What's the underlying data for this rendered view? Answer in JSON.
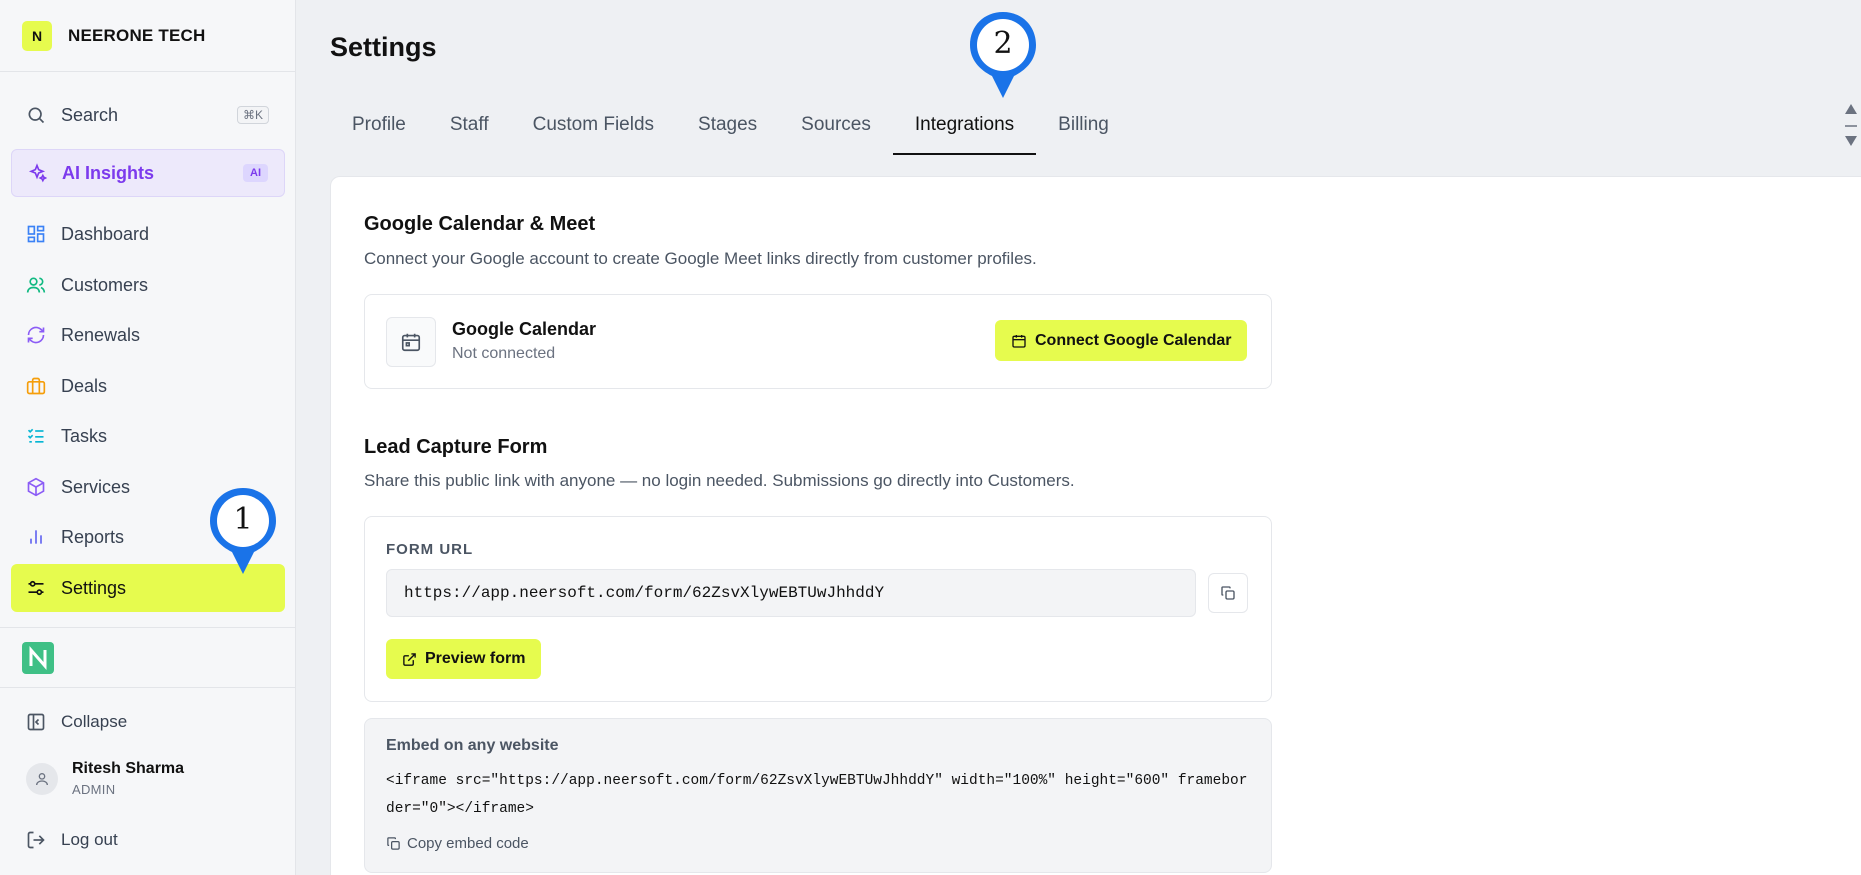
{
  "sidebar": {
    "brand": {
      "logo_letter": "N",
      "name": "NEERONE TECH"
    },
    "search": {
      "label": "Search",
      "shortcut": "⌘K"
    },
    "ai": {
      "label": "AI Insights",
      "badge": "AI"
    },
    "items": [
      {
        "label": "Dashboard",
        "icon": "grid-icon"
      },
      {
        "label": "Customers",
        "icon": "users-icon"
      },
      {
        "label": "Renewals",
        "icon": "refresh-icon"
      },
      {
        "label": "Deals",
        "icon": "briefcase-icon"
      },
      {
        "label": "Tasks",
        "icon": "checklist-icon"
      },
      {
        "label": "Services",
        "icon": "box-icon"
      },
      {
        "label": "Reports",
        "icon": "bar-chart-icon"
      },
      {
        "label": "Settings",
        "icon": "sliders-icon",
        "active": true
      }
    ],
    "collapse_label": "Collapse",
    "user": {
      "name": "Ritesh Sharma",
      "role": "ADMIN"
    },
    "logout_label": "Log out"
  },
  "main": {
    "title": "Settings",
    "tabs": [
      {
        "label": "Profile"
      },
      {
        "label": "Staff"
      },
      {
        "label": "Custom Fields"
      },
      {
        "label": "Stages"
      },
      {
        "label": "Sources"
      },
      {
        "label": "Integrations",
        "active": true
      },
      {
        "label": "Billing"
      }
    ],
    "google": {
      "title": "Google Calendar & Meet",
      "description": "Connect your Google account to create Google Meet links directly from customer profiles.",
      "calendar_title": "Google Calendar",
      "status": "Not connected",
      "connect_label": "Connect Google Calendar"
    },
    "lead": {
      "title": "Lead Capture Form",
      "description": "Share this public link with anyone — no login needed. Submissions go directly into Customers.",
      "form_url_label": "FORM URL",
      "form_url": "https://app.neersoft.com/form/62ZsvXlywEBTUwJhhddY",
      "preview_label": "Preview form",
      "embed_label": "Embed on any website",
      "embed_code": "<iframe src=\"https://app.neersoft.com/form/62ZsvXlywEBTUwJhhddY\" width=\"100%\" height=\"600\" frameborder=\"0\"></iframe>",
      "copy_embed_label": "Copy embed code"
    }
  },
  "markers": [
    {
      "number": "1"
    },
    {
      "number": "2"
    }
  ],
  "colors": {
    "accent": "#e6fb4e",
    "ai": "#7c3aed",
    "marker": "#1a73e8"
  }
}
